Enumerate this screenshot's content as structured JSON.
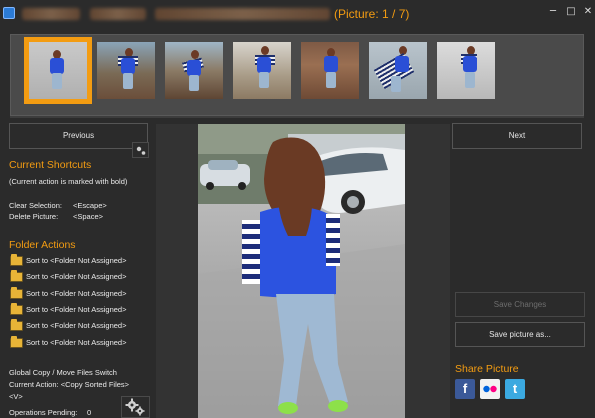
{
  "titlebar": {
    "picture_counter": "(Picture: 1 / 7)",
    "minimize_glyph": "─",
    "maximize_glyph": "□",
    "close_glyph": "✕"
  },
  "thumbnails": {
    "count": 7,
    "selected_index": 0
  },
  "nav": {
    "previous_label": "Previous",
    "next_label": "Next"
  },
  "shortcuts": {
    "title": "Current Shortcuts",
    "subtitle": "(Current action is marked with bold)",
    "items": [
      {
        "label": "Clear Selection:",
        "key": "<Escape>"
      },
      {
        "label": "Delete Picture:",
        "key": "<Space>"
      }
    ]
  },
  "folder_actions": {
    "title": "Folder Actions",
    "items": [
      "Sort to <Folder Not Assigned>",
      "Sort to <Folder Not Assigned>",
      "Sort to <Folder Not Assigned>",
      "Sort to <Folder Not Assigned>",
      "Sort to <Folder Not Assigned>",
      "Sort to <Folder Not Assigned>"
    ]
  },
  "global_switch": {
    "line1": "Global Copy / Move Files Switch",
    "line2": "Current Action: <Copy Sorted Files>",
    "line3": "<V>",
    "pending_label": "Operations Pending:",
    "pending_count": "0"
  },
  "actions": {
    "save_changes_label": "Save Changes",
    "save_as_label": "Save picture as..."
  },
  "share": {
    "title": "Share Picture",
    "facebook_glyph": "f",
    "flickr_glyph": "●●",
    "twitter_glyph": "t"
  },
  "colors": {
    "accent": "#f39c12",
    "background": "#2b2b2b",
    "facebook": "#3b5998",
    "twitter": "#3ba9e0"
  }
}
